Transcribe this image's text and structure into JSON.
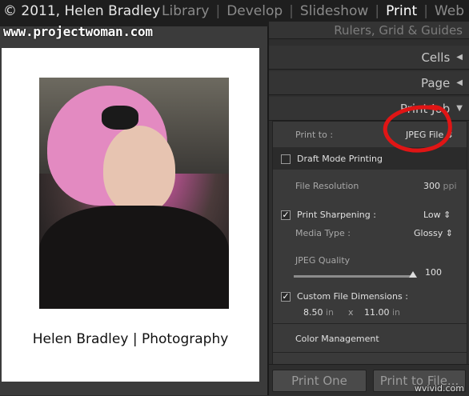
{
  "topbar": {
    "copyright": "© 2011, Helen Bradley",
    "modules": [
      {
        "label": "Library",
        "active": false
      },
      {
        "label": "Develop",
        "active": false
      },
      {
        "label": "Slideshow",
        "active": false
      },
      {
        "label": "Print",
        "active": true
      },
      {
        "label": "Web",
        "active": false
      }
    ]
  },
  "watermark": "www.projectwoman.com",
  "print_preview": {
    "caption": "Helen Bradley | Photography"
  },
  "panel": {
    "sections": {
      "rulers": "Rulers, Grid & Guides",
      "cells": "Cells",
      "page": "Page",
      "print_job": "Print Job"
    },
    "print_to_label": "Print to :",
    "print_to_value": "JPEG File",
    "draft_mode_label": "Draft Mode Printing",
    "file_resolution_label": "File Resolution",
    "file_resolution_value": "300",
    "file_resolution_unit": "ppi",
    "print_sharpening_label": "Print Sharpening :",
    "print_sharpening_value": "Low",
    "media_type_label": "Media Type :",
    "media_type_value": "Glossy",
    "jpeg_quality_label": "JPEG Quality",
    "jpeg_quality_value": "100",
    "custom_dims_label": "Custom File Dimensions :",
    "width_value": "8.50",
    "width_unit": "in",
    "times": "x",
    "height_value": "11.00",
    "height_unit": "in",
    "color_management": "Color Management"
  },
  "buttons": {
    "print_one": "Print One",
    "print_to_file": "Print to File..."
  },
  "credit": "wvivid.com",
  "colors": {
    "annotation": "#e01515",
    "background": "#2b2b2b",
    "active_module": "#ffffff"
  }
}
